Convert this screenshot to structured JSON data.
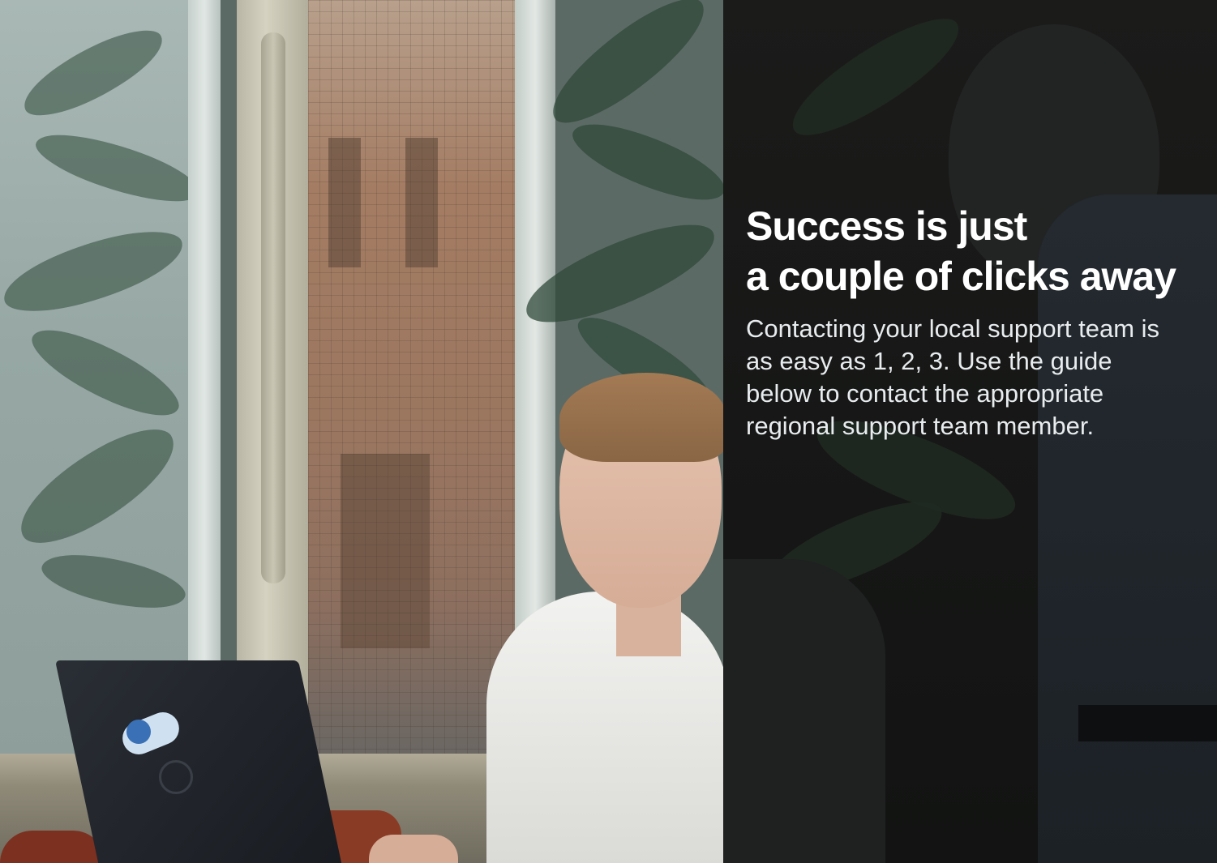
{
  "hero": {
    "headline_line1": "Success is just",
    "headline_line2": "a couple of clicks away",
    "body": "Contacting your local support team is as easy as 1, 2, 3.  Use the guide below to contact the appropriate regional support team member."
  },
  "colors": {
    "panel_background": "#161716",
    "headline_text": "#ffffff",
    "body_text": "#e8ecee"
  }
}
